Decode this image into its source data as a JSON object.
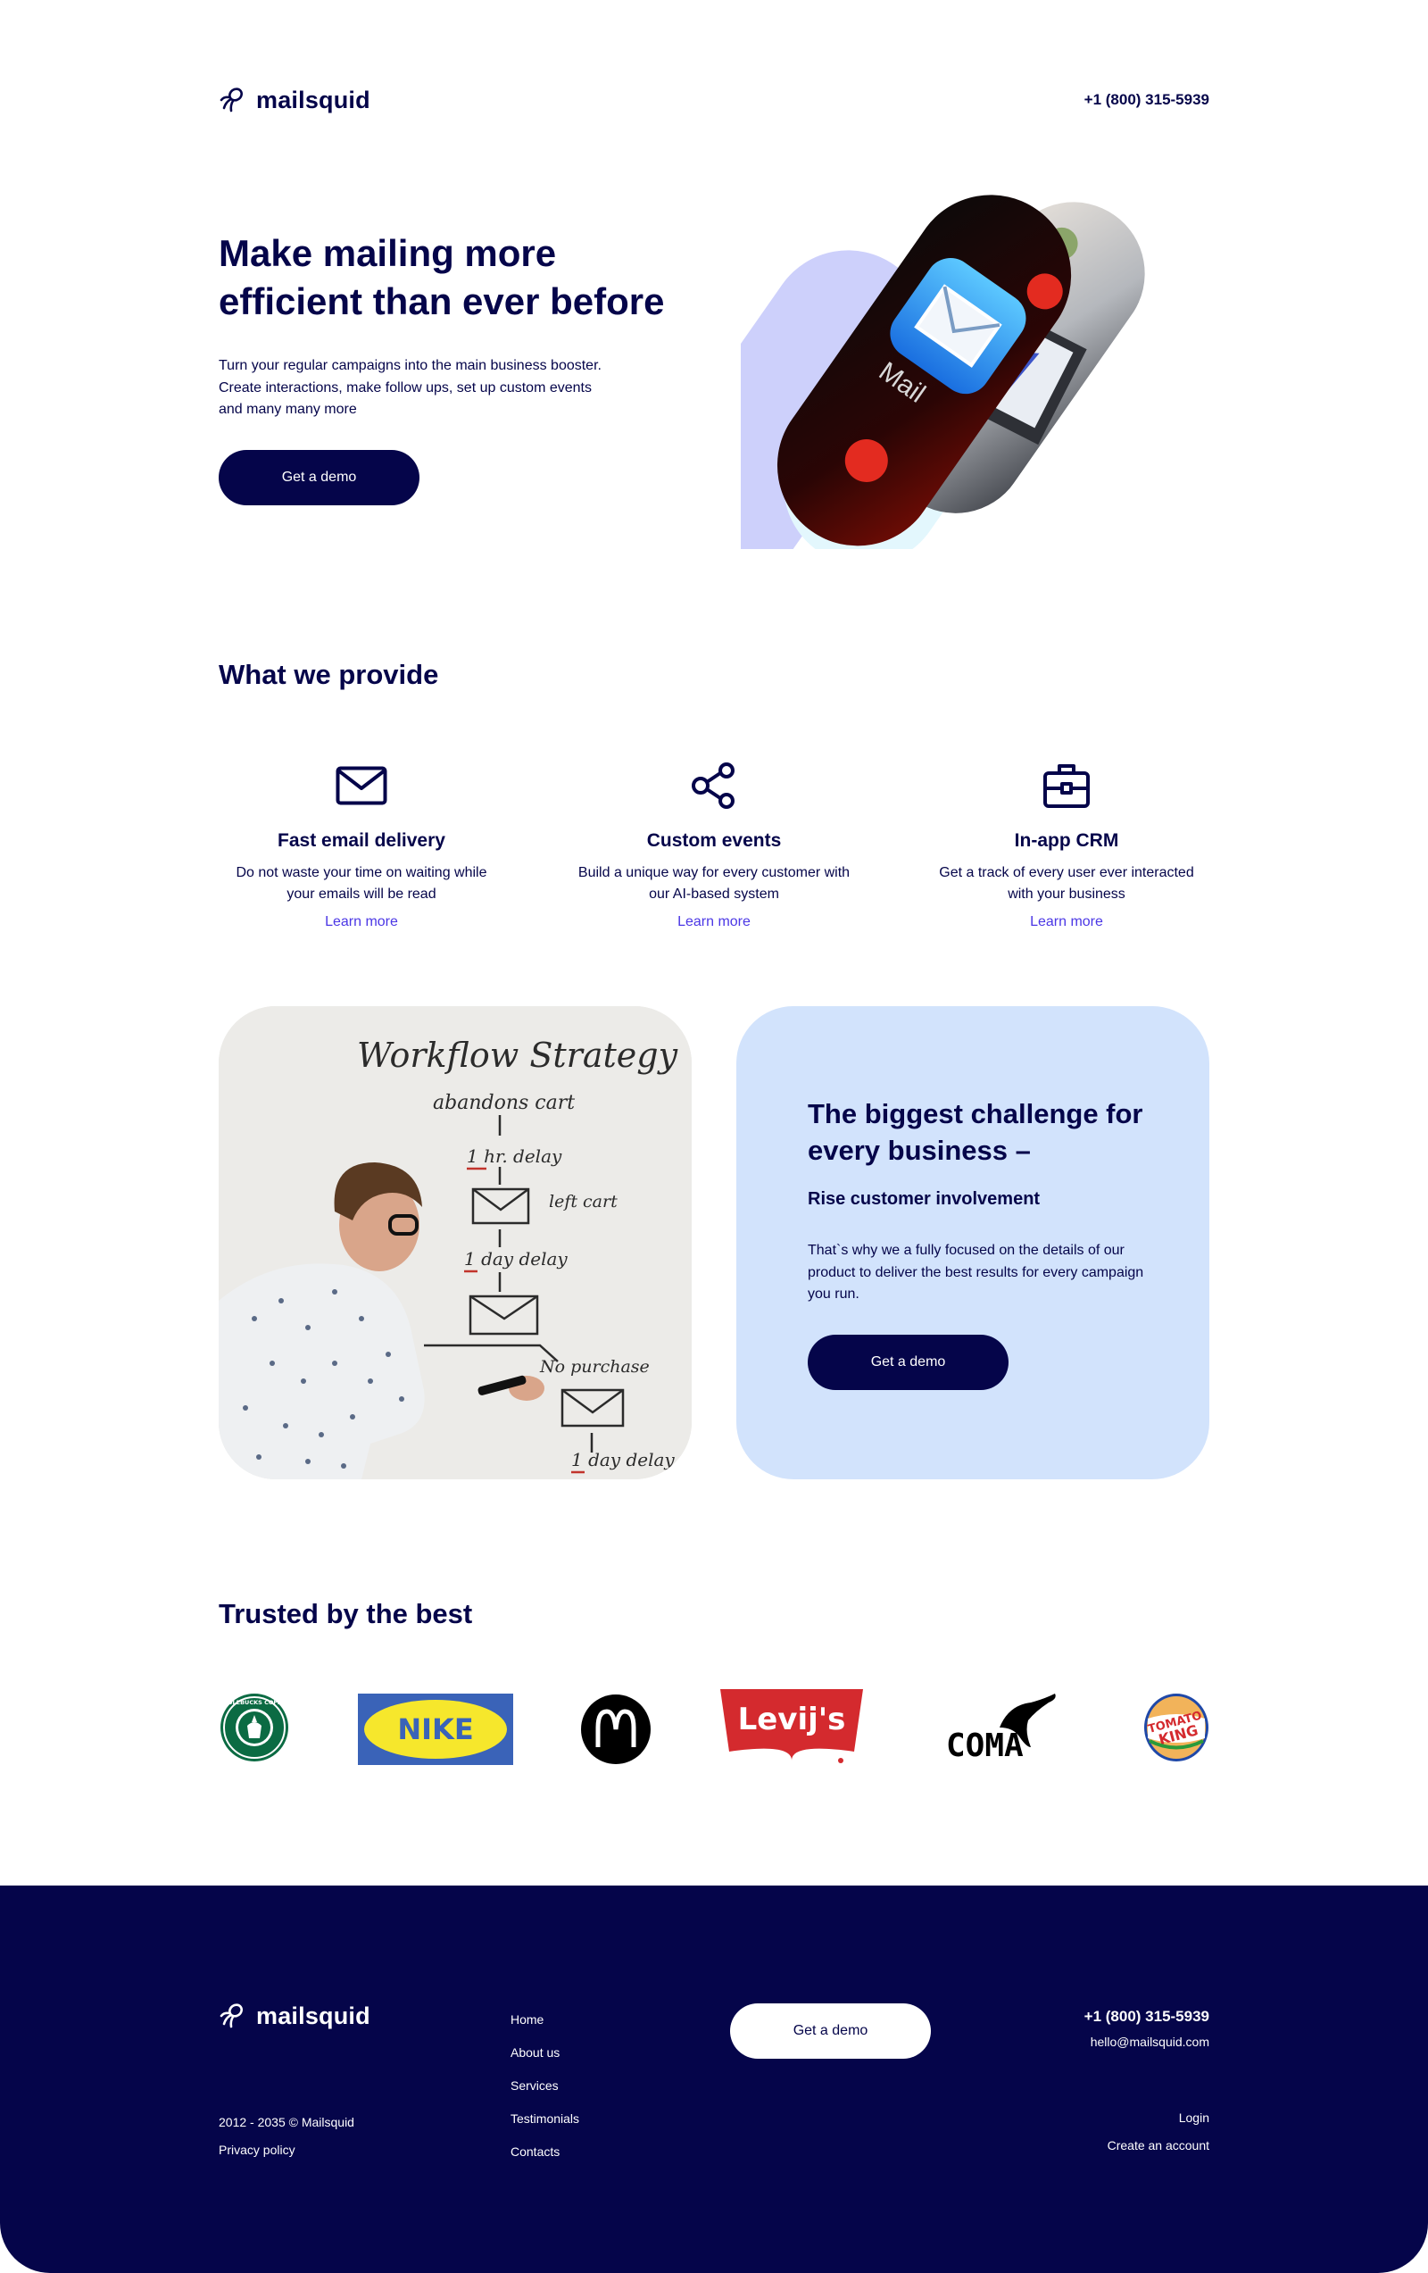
{
  "brand": {
    "name": "mailsquid"
  },
  "header": {
    "phone": "+1 (800) 315-5939"
  },
  "hero": {
    "title_line1": "Make mailing more",
    "title_line2": "efficient than ever before",
    "text": "Turn your regular campaigns into the main business booster. Create interactions, make follow ups, set up custom events and many many more",
    "cta": "Get a demo",
    "mail_app_label": "Mail"
  },
  "provide": {
    "title": "What we provide",
    "items": [
      {
        "icon": "envelope-icon",
        "title": "Fast email delivery",
        "text": "Do not waste your  time on waiting while your emails will be read",
        "link": "Learn more"
      },
      {
        "icon": "share-nodes-icon",
        "title": "Custom events",
        "text": "Build a unique way for every customer with our AI-based system",
        "link": "Learn more"
      },
      {
        "icon": "briefcase-icon",
        "title": "In-app CRM",
        "text": "Get a track of every user ever interacted with your business",
        "link": "Learn more"
      }
    ]
  },
  "whiteboard": {
    "title": "Workflow Strategy",
    "lines": [
      "abandons cart",
      "1 hr. delay",
      "left cart",
      "1 day delay",
      "No purchase",
      "1 day delay"
    ]
  },
  "challenge": {
    "title": "The biggest challenge for every business –",
    "subtitle": "Rise customer involvement",
    "text": "That`s why we a fully focused on the details of our product to deliver the best results for every campaign you run.",
    "cta": "Get a demo"
  },
  "trusted": {
    "title": "Trusted by the best",
    "logos": [
      {
        "name": "starbucks-style",
        "text": "STOLEBUCKS COFFEE"
      },
      {
        "name": "nike-style",
        "text": "NIKE"
      },
      {
        "name": "mcdonalds-style",
        "text": "M"
      },
      {
        "name": "levis-style",
        "text": "Levij's"
      },
      {
        "name": "puma-style",
        "text": "COMA"
      },
      {
        "name": "burger-king-style",
        "text": "TOMATO KING"
      }
    ]
  },
  "footer": {
    "copyright": "2012 - 2035 © Mailsquid",
    "privacy": "Privacy policy",
    "nav": [
      "Home",
      "About us",
      "Services",
      "Testimonials",
      "Contacts"
    ],
    "cta": "Get a demo",
    "phone": "+1 (800) 315-5939",
    "email": "hello@mailsquid.com",
    "login": "Login",
    "create_account": "Create an account"
  },
  "colors": {
    "navy": "#05054a",
    "link": "#4b37e5",
    "card_blue": "#d2e3fc",
    "lavender": "#cdd0fb",
    "pale_cyan": "#e3f7fd"
  }
}
